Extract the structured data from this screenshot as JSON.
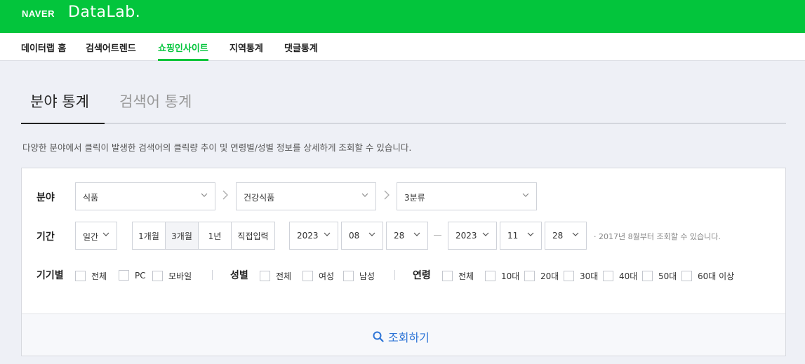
{
  "header": {
    "brand_naver": "NAVER",
    "brand_datalab": "DataLab."
  },
  "nav": {
    "items": [
      {
        "label": "데이터랩 홈"
      },
      {
        "label": "검색어트렌드"
      },
      {
        "label": "쇼핑인사이트"
      },
      {
        "label": "지역통계"
      },
      {
        "label": "댓글통계"
      }
    ],
    "active": "쇼핑인사이트"
  },
  "tabs": {
    "active": "분야 통계",
    "inactive": "검색어 통계"
  },
  "description": "다양한 분야에서 클릭이 발생한 검색어의 클릭량 추이 및 연령별/성별 정보를 상세하게 조회할 수 있습니다.",
  "form": {
    "category": {
      "label": "분야",
      "level1": "식품",
      "level2": "건강식품",
      "level3": "3분류"
    },
    "period": {
      "label": "기간",
      "unit": "일간",
      "presets": [
        "1개월",
        "3개월",
        "1년",
        "직접입력"
      ],
      "active_preset": "3개월",
      "start": {
        "year": "2023",
        "month": "08",
        "day": "28"
      },
      "end": {
        "year": "2023",
        "month": "11",
        "day": "28"
      },
      "note": "· 2017년 8월부터 조회할 수 있습니다."
    },
    "device": {
      "label": "기기별",
      "options": [
        "전체",
        "PC",
        "모바일"
      ]
    },
    "gender": {
      "label": "성별",
      "options": [
        "전체",
        "여성",
        "남성"
      ]
    },
    "age": {
      "label": "연령",
      "options": [
        "전체",
        "10대",
        "20대",
        "30대",
        "40대",
        "50대",
        "60대 이상"
      ]
    },
    "submit_label": "조회하기"
  },
  "colors": {
    "brand_green": "#03c53c",
    "link_blue": "#2d74d6"
  }
}
